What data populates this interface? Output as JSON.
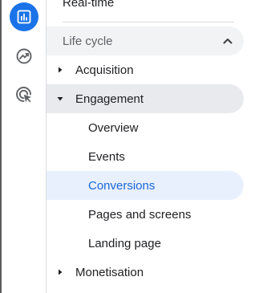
{
  "rail": {
    "items": [
      {
        "name": "reports",
        "icon": "bar-chart-icon",
        "active": true
      },
      {
        "name": "explore",
        "icon": "explore-trend-icon",
        "active": false
      },
      {
        "name": "advertising",
        "icon": "advertising-cursor-icon",
        "active": false
      }
    ]
  },
  "nav": {
    "top_item": "Real-time",
    "section": {
      "label": "Life cycle",
      "expanded": true
    },
    "groups": [
      {
        "label": "Acquisition",
        "expanded": false
      },
      {
        "label": "Engagement",
        "expanded": true
      },
      {
        "label": "Monetisation",
        "expanded": false
      }
    ],
    "engagement_items": [
      {
        "label": "Overview"
      },
      {
        "label": "Events"
      },
      {
        "label": "Conversions",
        "selected": true
      },
      {
        "label": "Pages and screens"
      },
      {
        "label": "Landing page"
      }
    ]
  },
  "colors": {
    "accent": "#1a73e8",
    "selected_bg": "#e8f0fe",
    "selected_text": "#1967d2",
    "hover_bg": "#e8eaed"
  }
}
